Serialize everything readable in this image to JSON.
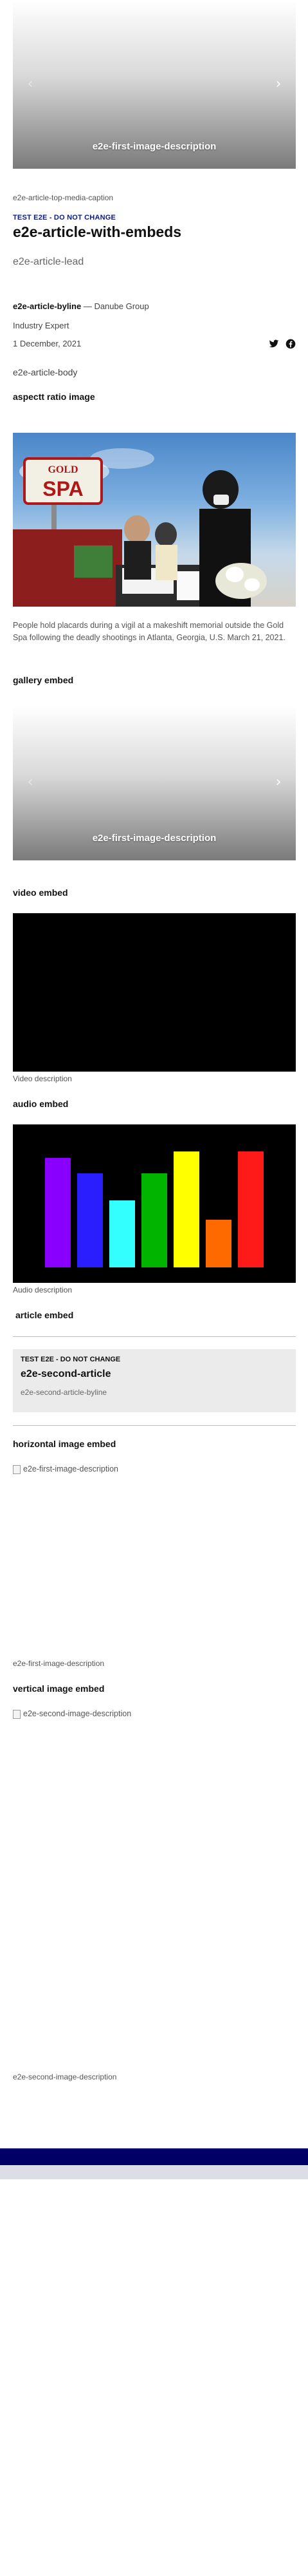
{
  "hero": {
    "caption": "e2e-first-image-description",
    "prev_arrow": "‹",
    "next_arrow": "›"
  },
  "top_media_caption": "e2e-article-top-media-caption",
  "article": {
    "tag": "TEST E2E - DO NOT CHANGE",
    "title": "e2e-article-with-embeds",
    "lead": "e2e-article-lead",
    "byline_name": "e2e-article-byline",
    "byline_org": " — Danube Group",
    "byline_role": "Industry Expert",
    "date": "1 December, 2021",
    "body": "e2e-article-body"
  },
  "share": {
    "icons": [
      "twitter-icon",
      "facebook-icon"
    ],
    "twitter_color": "#111111",
    "facebook_color": "#111111"
  },
  "sections": {
    "aspect_ratio": "aspectt ratio image",
    "gallery": "gallery embed",
    "video": "video embed",
    "audio": "audio embed",
    "article": "article embed",
    "horizontal": "horizontal image embed",
    "vertical": "vertical image embed"
  },
  "photo": {
    "sign_top": "GOLD",
    "sign_main": "SPA",
    "caption": "People hold placards during a vigil at a makeshift memorial outside the Gold Spa following the deadly shootings in Atlanta, Georgia, U.S. March 21, 2021."
  },
  "gallery_embed": {
    "caption": "e2e-first-image-description",
    "prev_arrow": "‹",
    "next_arrow": "›"
  },
  "video_embed": {
    "description": "Video description"
  },
  "audio_embed": {
    "description": "Audio description",
    "bars": [
      {
        "color": "#8a00ff",
        "level": 0.85
      },
      {
        "color": "#2a1eff",
        "level": 0.73
      },
      {
        "color": "#33ffff",
        "level": 0.52
      },
      {
        "color": "#00b400",
        "level": 0.73
      },
      {
        "color": "#ffff00",
        "level": 0.9
      },
      {
        "color": "#ff6a00",
        "level": 0.37
      },
      {
        "color": "#ff1a1a",
        "level": 0.9
      }
    ]
  },
  "article_embed": {
    "tag": "TEST E2E - DO NOT CHANGE",
    "title": "e2e-second-article",
    "byline": "e2e-second-article-byline"
  },
  "horizontal_image": {
    "alt": "e2e-first-image-description",
    "caption": "e2e-first-image-description"
  },
  "vertical_image": {
    "alt": "e2e-second-image-description",
    "caption": "e2e-second-image-description"
  },
  "colors": {
    "accent": "#0a1a8c",
    "footer_dark": "#000066",
    "footer_light": "#dcdde6"
  }
}
